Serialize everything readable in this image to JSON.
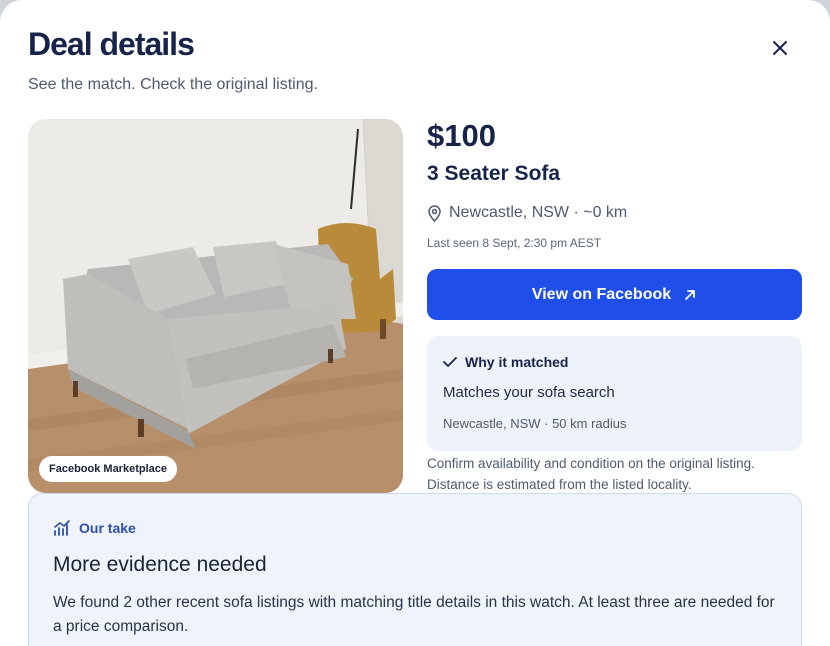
{
  "dialog": {
    "title": "Deal details",
    "subtitle": "See the match. Check the original listing.",
    "close_icon": "close-icon"
  },
  "listing": {
    "source_badge": "Facebook Marketplace",
    "price": "$100",
    "title": "3 Seater Sofa",
    "location": "Newcastle, NSW · ~0 km",
    "last_seen": "Last seen 8 Sept, 2:30 pm AEST",
    "view_button": "View on Facebook",
    "icons": {
      "location": "map-pin-icon",
      "external": "arrow-up-right-icon"
    }
  },
  "why_matched": {
    "heading": "Why it matched",
    "reason": "Matches your sofa search",
    "criteria": "Newcastle, NSW · 50 km radius",
    "icon": "check-icon"
  },
  "note": {
    "line1": "Confirm availability and condition on the original listing.",
    "line2": "Distance is estimated from the listed locality."
  },
  "our_take": {
    "heading": "Our take",
    "title": "More evidence needed",
    "body": "We found 2 other recent sofa listings with matching title details in this watch. At least three are needed for a price comparison.",
    "icon": "chart-icon"
  },
  "colors": {
    "primary": "#1f4fe8",
    "heading": "#17244a",
    "card": "#edf2fb"
  }
}
